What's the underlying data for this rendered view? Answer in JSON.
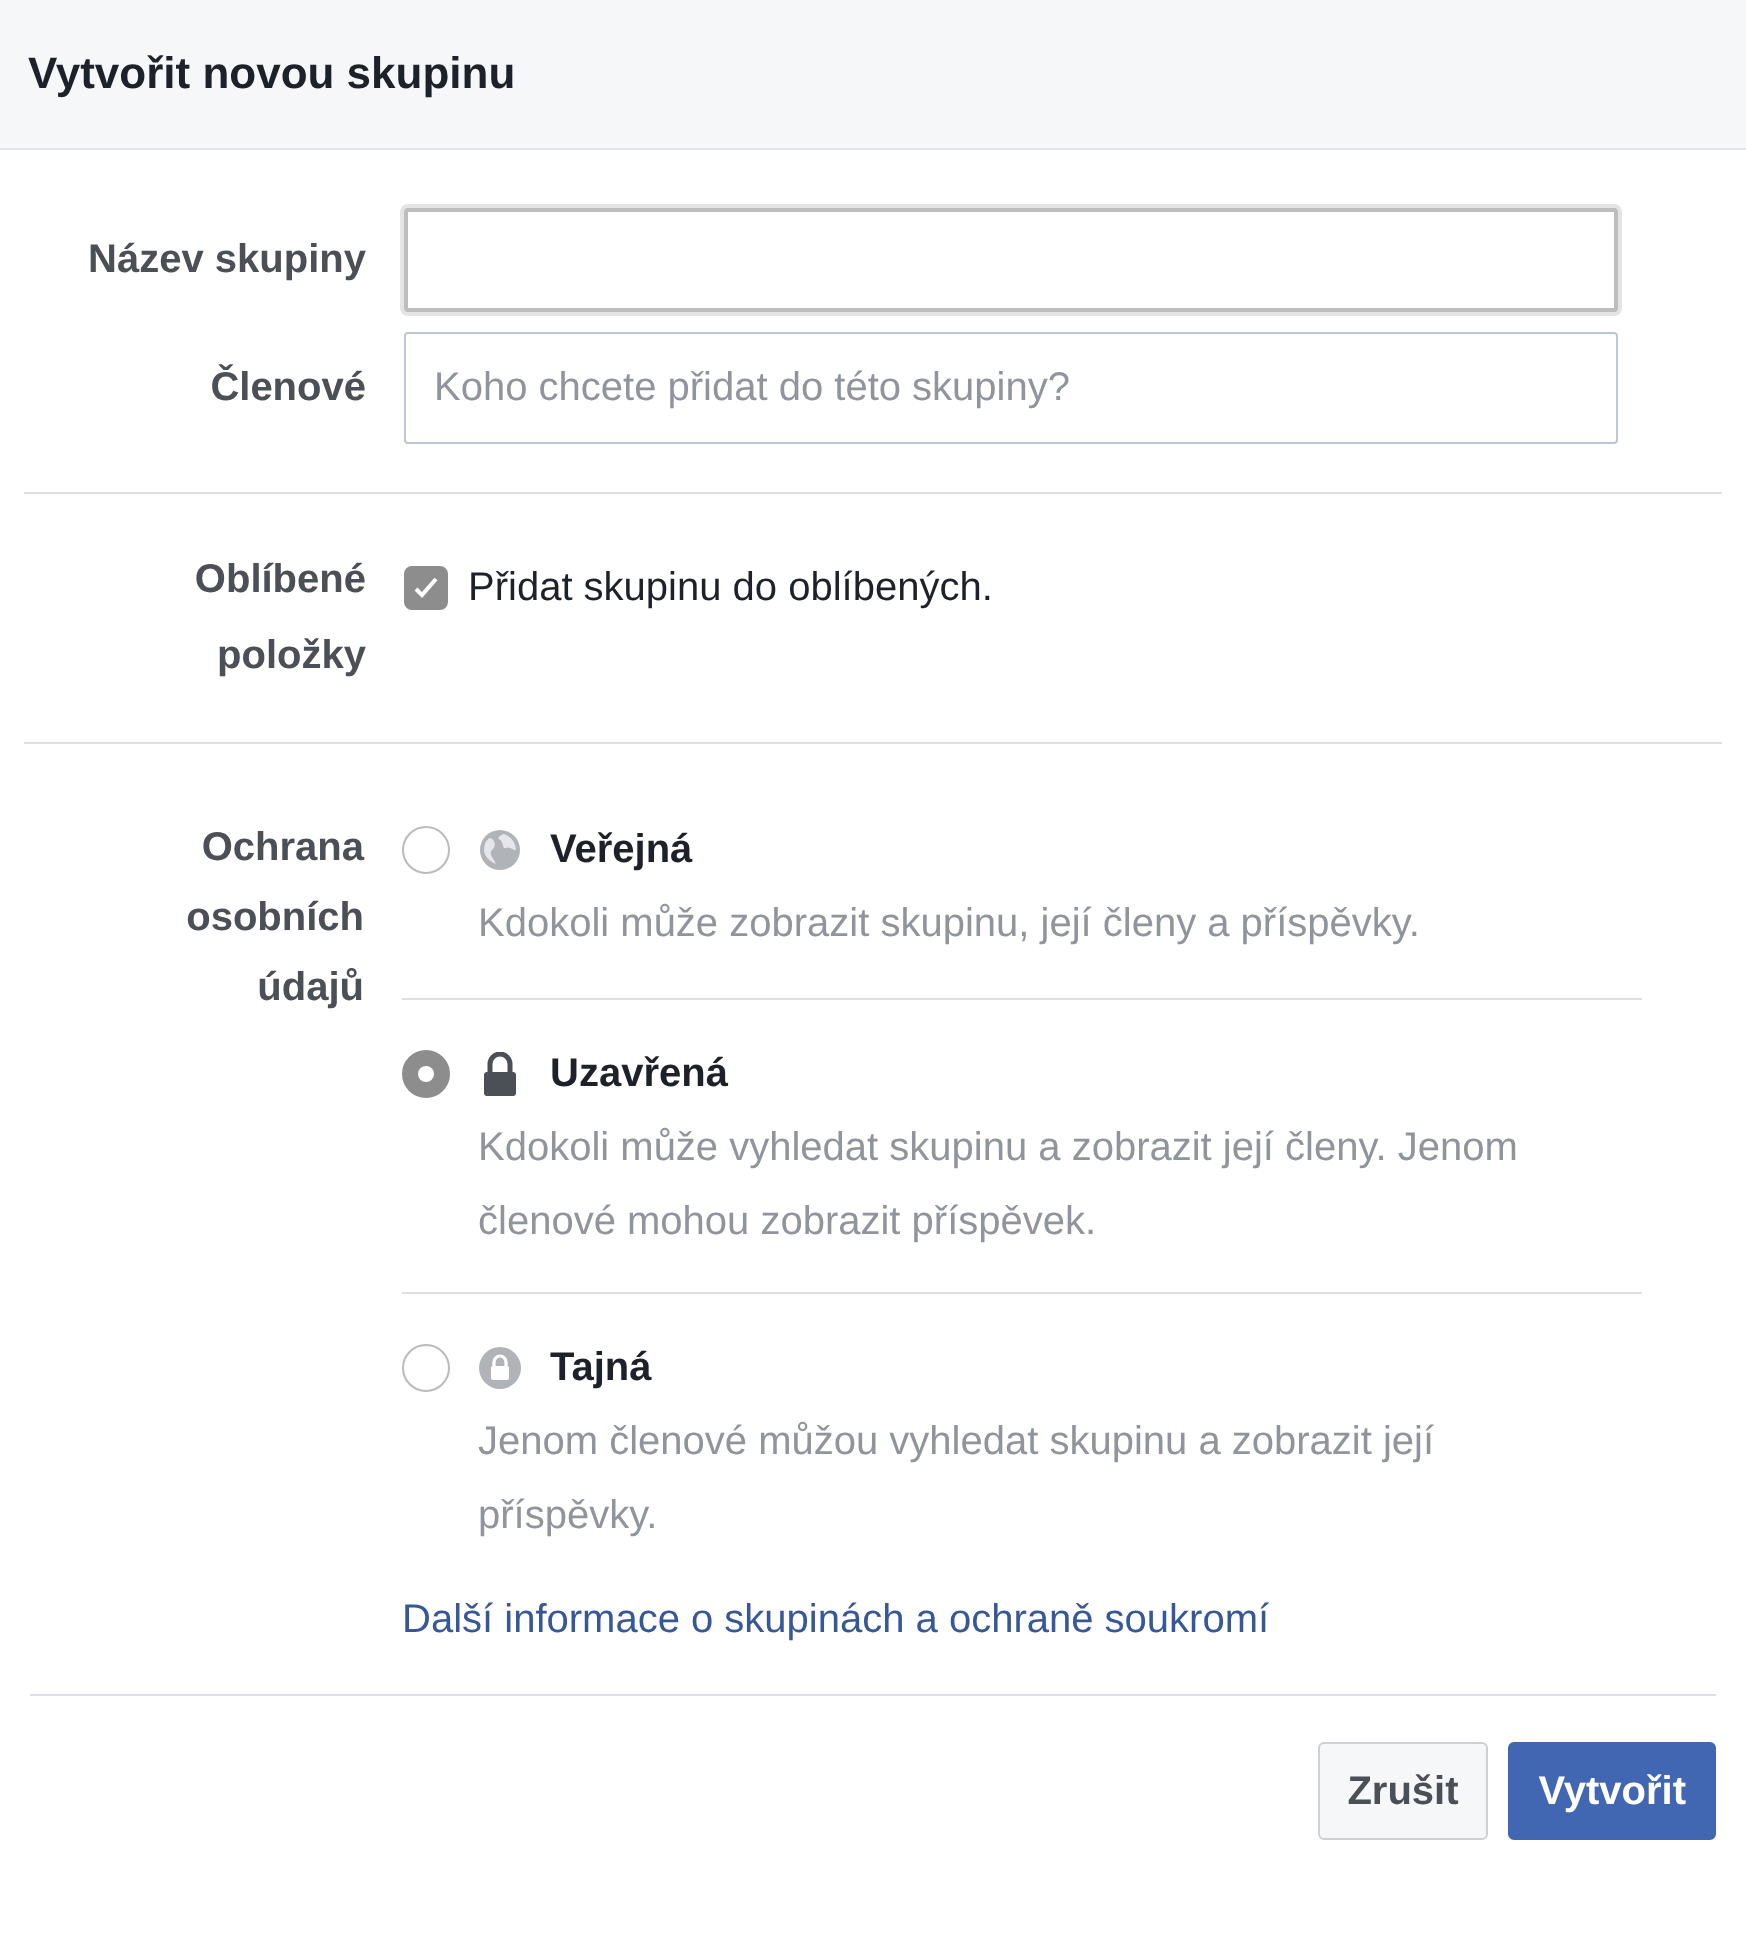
{
  "dialog": {
    "title": "Vytvořit novou skupinu"
  },
  "fields": [
    {
      "label": "Název skupiny",
      "focused": true
    },
    {
      "label": "Členové",
      "placeholder": "Koho chcete přidat do této skupiny?",
      "focused": false
    }
  ],
  "favorites": {
    "label": "Oblíbené položky",
    "text": "Přidat skupinu do oblíbených.",
    "checked": true
  },
  "privacy": {
    "label": "Ochrana osobních údajů",
    "options": [
      {
        "kind": "public",
        "title": "Veřejná",
        "description": "Kdokoli může zobrazit skupinu, její členy a příspěvky.",
        "selected": false
      },
      {
        "kind": "closed",
        "title": "Uzavřená",
        "description": "Kdokoli může vyhledat skupinu a zobrazit její členy. Jenom členové mohou zobrazit příspěvek.",
        "selected": true
      },
      {
        "kind": "secret",
        "title": "Tajná",
        "description": "Jenom členové můžou vyhledat skupinu a zobrazit její příspěvky.",
        "selected": false
      }
    ],
    "link": "Další informace o skupinách a ochraně soukromí"
  },
  "buttons": [
    {
      "label": "Zrušit",
      "kind": "secondary"
    },
    {
      "label": "Vytvořit",
      "kind": "primary"
    }
  ]
}
